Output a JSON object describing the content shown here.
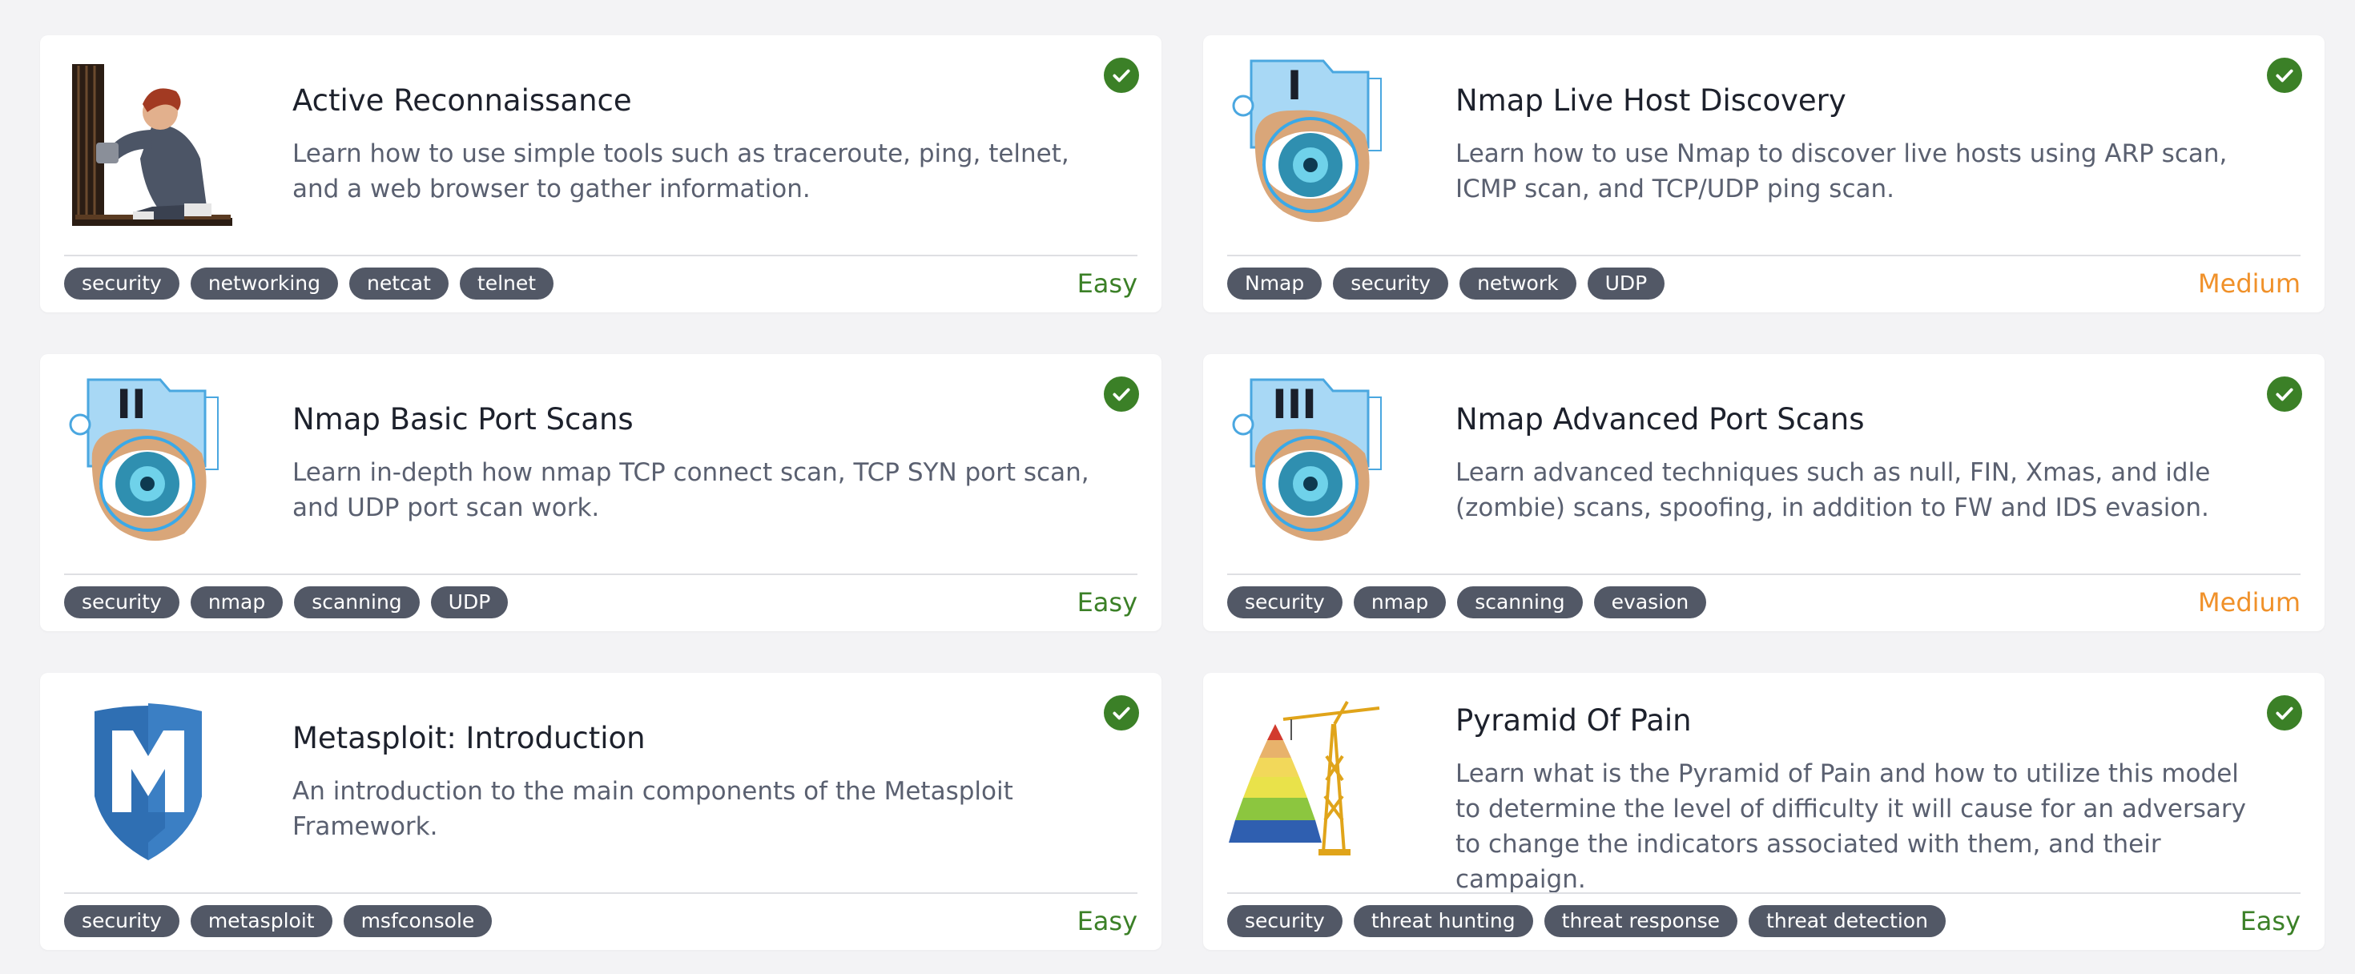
{
  "colors": {
    "easy": "#3b8027",
    "medium": "#f0912a",
    "tag_bg": "#525866",
    "check": "#3b8027"
  },
  "rooms": [
    {
      "title": "Active Reconnaissance",
      "description": "Learn how to use simple tools such as traceroute, ping, telnet, and a web browser to gather information.",
      "tags": [
        "security",
        "networking",
        "netcat",
        "telnet"
      ],
      "difficulty": "Easy",
      "completed_icon": "check-circle-icon",
      "thumbnail_icon": "hacker-lockpick-icon"
    },
    {
      "title": "Nmap Live Host Discovery",
      "description": "Learn how to use Nmap to discover live hosts using ARP scan, ICMP scan, and TCP/UDP ping scan.",
      "tags": [
        "Nmap",
        "security",
        "network",
        "UDP"
      ],
      "difficulty": "Medium",
      "completed_icon": "check-circle-icon",
      "thumbnail_icon": "nmap-eye-icon",
      "thumbnail_numeral": "I"
    },
    {
      "title": "Nmap Basic Port Scans",
      "description": "Learn in-depth how nmap TCP connect scan, TCP SYN port scan, and UDP port scan work.",
      "tags": [
        "security",
        "nmap",
        "scanning",
        "UDP"
      ],
      "difficulty": "Easy",
      "completed_icon": "check-circle-icon",
      "thumbnail_icon": "nmap-eye-icon",
      "thumbnail_numeral": "II"
    },
    {
      "title": "Nmap Advanced Port Scans",
      "description": "Learn advanced techniques such as null, FIN, Xmas, and idle (zombie) scans, spoofing, in addition to FW and IDS evasion.",
      "tags": [
        "security",
        "nmap",
        "scanning",
        "evasion"
      ],
      "difficulty": "Medium",
      "completed_icon": "check-circle-icon",
      "thumbnail_icon": "nmap-eye-icon",
      "thumbnail_numeral": "III"
    },
    {
      "title": "Metasploit: Introduction",
      "description": "An introduction to the main components of the Metasploit Framework.",
      "tags": [
        "security",
        "metasploit",
        "msfconsole"
      ],
      "difficulty": "Easy",
      "completed_icon": "check-circle-icon",
      "thumbnail_icon": "metasploit-shield-icon"
    },
    {
      "title": "Pyramid Of Pain",
      "description": "Learn what is the Pyramid of Pain and how to utilize this model to determine the level of difficulty it will cause for an adversary to change the indicators associated with them, and their campaign.",
      "tags": [
        "security",
        "threat hunting",
        "threat response",
        "threat detection"
      ],
      "difficulty": "Easy",
      "completed_icon": "check-circle-icon",
      "thumbnail_icon": "pyramid-crane-icon"
    }
  ]
}
